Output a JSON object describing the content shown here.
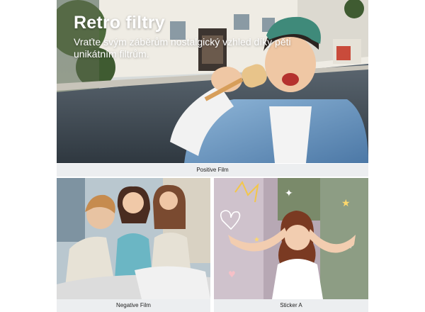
{
  "hero": {
    "title": "Retro filtry",
    "subtitle": "Vraťte svým záběrům nostalgický vzhled díky pěti unikátním filtrům.",
    "caption": "Positive Film"
  },
  "panels": [
    {
      "caption": "Negative Film"
    },
    {
      "caption": "Sticker A"
    }
  ]
}
